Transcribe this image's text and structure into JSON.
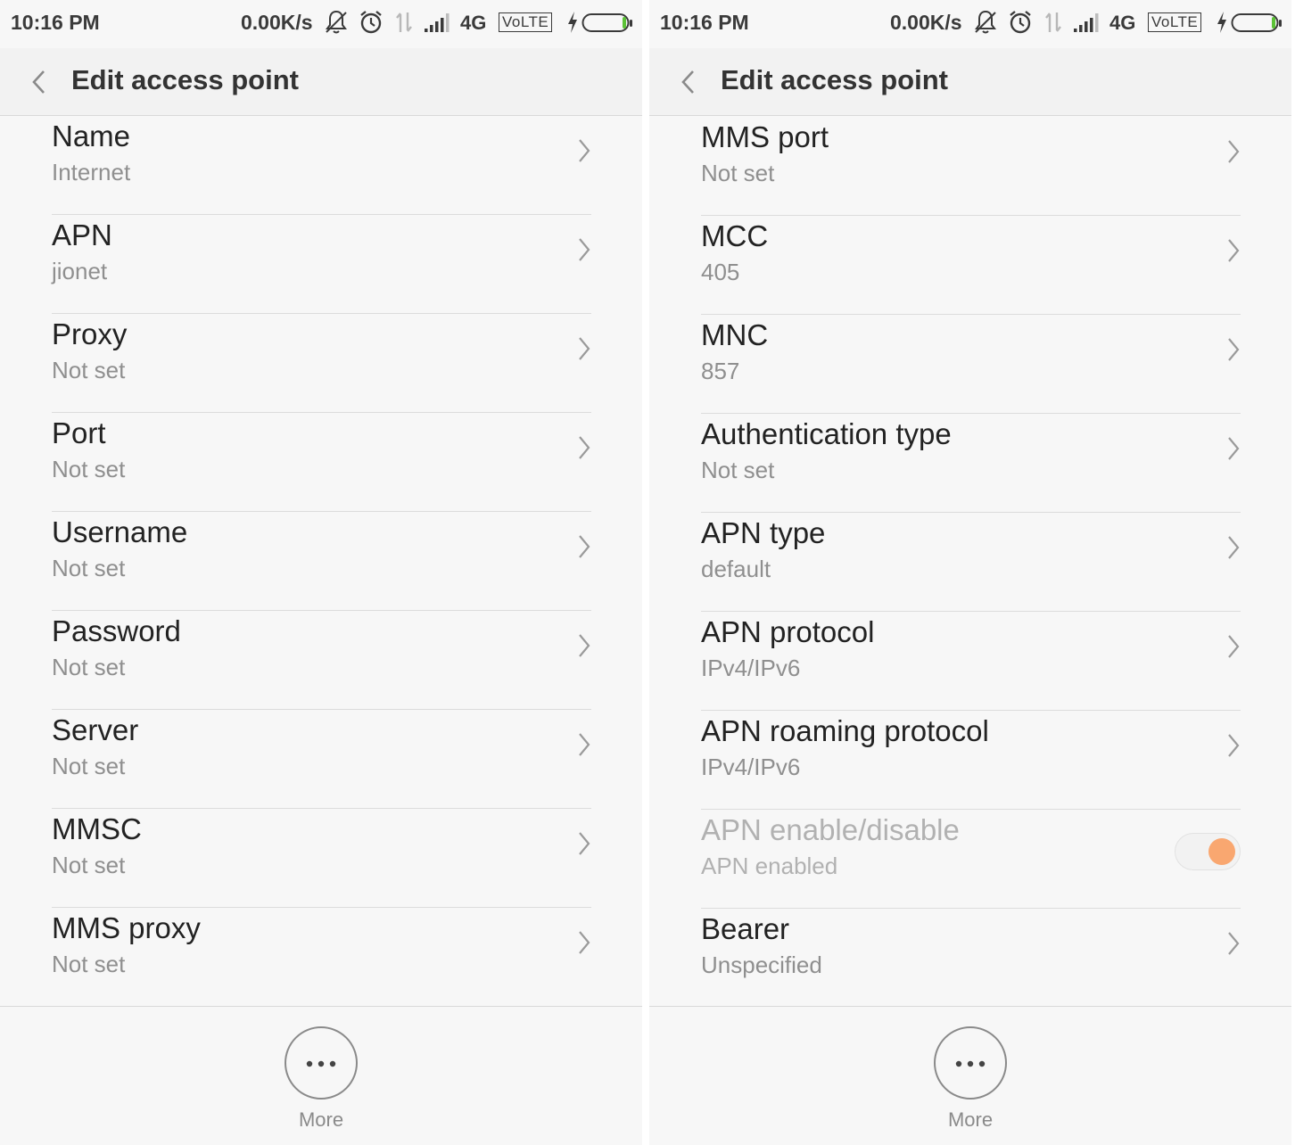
{
  "status_bar": {
    "time": "10:16 PM",
    "speed": "0.00K/s",
    "network": "4G",
    "volte": "VoLTE",
    "icons": [
      "mute-icon",
      "alarm-icon",
      "data-arrows-icon",
      "signal-icon",
      "charging-icon",
      "battery-icon"
    ]
  },
  "header": {
    "title": "Edit access point",
    "back_icon": "chevron-left-icon"
  },
  "left_screen": {
    "rows": [
      {
        "title": "Name",
        "value": "Internet"
      },
      {
        "title": "APN",
        "value": "jionet"
      },
      {
        "title": "Proxy",
        "value": "Not set"
      },
      {
        "title": "Port",
        "value": "Not set"
      },
      {
        "title": "Username",
        "value": "Not set"
      },
      {
        "title": "Password",
        "value": "Not set"
      },
      {
        "title": "Server",
        "value": "Not set"
      },
      {
        "title": "MMSC",
        "value": "Not set"
      },
      {
        "title": "MMS proxy",
        "value": "Not set"
      }
    ]
  },
  "right_screen": {
    "rows": [
      {
        "title": "MMS port",
        "value": "Not set"
      },
      {
        "title": "MCC",
        "value": "405"
      },
      {
        "title": "MNC",
        "value": "857"
      },
      {
        "title": "Authentication type",
        "value": "Not set"
      },
      {
        "title": "APN type",
        "value": "default"
      },
      {
        "title": "APN protocol",
        "value": "IPv4/IPv6"
      },
      {
        "title": "APN roaming protocol",
        "value": "IPv4/IPv6"
      },
      {
        "title": "APN enable/disable",
        "value": "APN enabled",
        "toggle": true,
        "toggle_on": true,
        "disabled": true
      },
      {
        "title": "Bearer",
        "value": "Unspecified"
      }
    ]
  },
  "bottom": {
    "more_label": "More",
    "more_icon": "more-dots-icon"
  },
  "colors": {
    "background": "#f7f7f7",
    "app_bar": "#f2f2f2",
    "title_text": "#222222",
    "subtitle_text": "#8f8f8f",
    "toggle_accent": "#f9a770",
    "divider": "#dcdcdc"
  }
}
